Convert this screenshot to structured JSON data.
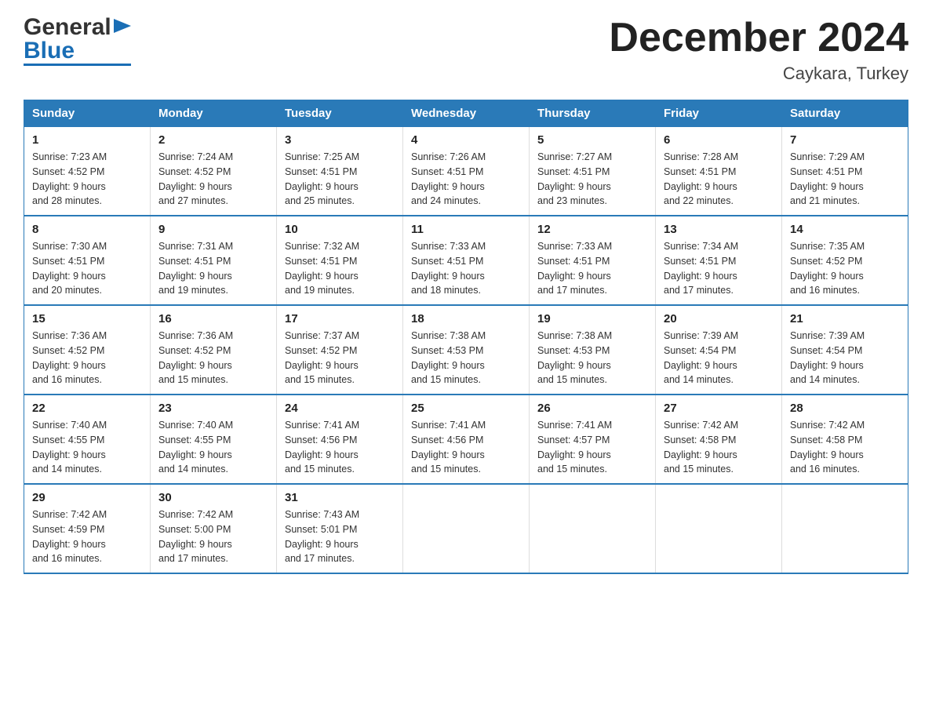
{
  "logo": {
    "text_general": "General",
    "text_blue": "Blue",
    "arrow": "▶"
  },
  "title": {
    "month_year": "December 2024",
    "location": "Caykara, Turkey"
  },
  "weekdays": [
    "Sunday",
    "Monday",
    "Tuesday",
    "Wednesday",
    "Thursday",
    "Friday",
    "Saturday"
  ],
  "weeks": [
    [
      {
        "day": "1",
        "sunrise": "7:23 AM",
        "sunset": "4:52 PM",
        "daylight": "9 hours and 28 minutes."
      },
      {
        "day": "2",
        "sunrise": "7:24 AM",
        "sunset": "4:52 PM",
        "daylight": "9 hours and 27 minutes."
      },
      {
        "day": "3",
        "sunrise": "7:25 AM",
        "sunset": "4:51 PM",
        "daylight": "9 hours and 25 minutes."
      },
      {
        "day": "4",
        "sunrise": "7:26 AM",
        "sunset": "4:51 PM",
        "daylight": "9 hours and 24 minutes."
      },
      {
        "day": "5",
        "sunrise": "7:27 AM",
        "sunset": "4:51 PM",
        "daylight": "9 hours and 23 minutes."
      },
      {
        "day": "6",
        "sunrise": "7:28 AM",
        "sunset": "4:51 PM",
        "daylight": "9 hours and 22 minutes."
      },
      {
        "day": "7",
        "sunrise": "7:29 AM",
        "sunset": "4:51 PM",
        "daylight": "9 hours and 21 minutes."
      }
    ],
    [
      {
        "day": "8",
        "sunrise": "7:30 AM",
        "sunset": "4:51 PM",
        "daylight": "9 hours and 20 minutes."
      },
      {
        "day": "9",
        "sunrise": "7:31 AM",
        "sunset": "4:51 PM",
        "daylight": "9 hours and 19 minutes."
      },
      {
        "day": "10",
        "sunrise": "7:32 AM",
        "sunset": "4:51 PM",
        "daylight": "9 hours and 19 minutes."
      },
      {
        "day": "11",
        "sunrise": "7:33 AM",
        "sunset": "4:51 PM",
        "daylight": "9 hours and 18 minutes."
      },
      {
        "day": "12",
        "sunrise": "7:33 AM",
        "sunset": "4:51 PM",
        "daylight": "9 hours and 17 minutes."
      },
      {
        "day": "13",
        "sunrise": "7:34 AM",
        "sunset": "4:51 PM",
        "daylight": "9 hours and 17 minutes."
      },
      {
        "day": "14",
        "sunrise": "7:35 AM",
        "sunset": "4:52 PM",
        "daylight": "9 hours and 16 minutes."
      }
    ],
    [
      {
        "day": "15",
        "sunrise": "7:36 AM",
        "sunset": "4:52 PM",
        "daylight": "9 hours and 16 minutes."
      },
      {
        "day": "16",
        "sunrise": "7:36 AM",
        "sunset": "4:52 PM",
        "daylight": "9 hours and 15 minutes."
      },
      {
        "day": "17",
        "sunrise": "7:37 AM",
        "sunset": "4:52 PM",
        "daylight": "9 hours and 15 minutes."
      },
      {
        "day": "18",
        "sunrise": "7:38 AM",
        "sunset": "4:53 PM",
        "daylight": "9 hours and 15 minutes."
      },
      {
        "day": "19",
        "sunrise": "7:38 AM",
        "sunset": "4:53 PM",
        "daylight": "9 hours and 15 minutes."
      },
      {
        "day": "20",
        "sunrise": "7:39 AM",
        "sunset": "4:54 PM",
        "daylight": "9 hours and 14 minutes."
      },
      {
        "day": "21",
        "sunrise": "7:39 AM",
        "sunset": "4:54 PM",
        "daylight": "9 hours and 14 minutes."
      }
    ],
    [
      {
        "day": "22",
        "sunrise": "7:40 AM",
        "sunset": "4:55 PM",
        "daylight": "9 hours and 14 minutes."
      },
      {
        "day": "23",
        "sunrise": "7:40 AM",
        "sunset": "4:55 PM",
        "daylight": "9 hours and 14 minutes."
      },
      {
        "day": "24",
        "sunrise": "7:41 AM",
        "sunset": "4:56 PM",
        "daylight": "9 hours and 15 minutes."
      },
      {
        "day": "25",
        "sunrise": "7:41 AM",
        "sunset": "4:56 PM",
        "daylight": "9 hours and 15 minutes."
      },
      {
        "day": "26",
        "sunrise": "7:41 AM",
        "sunset": "4:57 PM",
        "daylight": "9 hours and 15 minutes."
      },
      {
        "day": "27",
        "sunrise": "7:42 AM",
        "sunset": "4:58 PM",
        "daylight": "9 hours and 15 minutes."
      },
      {
        "day": "28",
        "sunrise": "7:42 AM",
        "sunset": "4:58 PM",
        "daylight": "9 hours and 16 minutes."
      }
    ],
    [
      {
        "day": "29",
        "sunrise": "7:42 AM",
        "sunset": "4:59 PM",
        "daylight": "9 hours and 16 minutes."
      },
      {
        "day": "30",
        "sunrise": "7:42 AM",
        "sunset": "5:00 PM",
        "daylight": "9 hours and 17 minutes."
      },
      {
        "day": "31",
        "sunrise": "7:43 AM",
        "sunset": "5:01 PM",
        "daylight": "9 hours and 17 minutes."
      },
      null,
      null,
      null,
      null
    ]
  ],
  "labels": {
    "sunrise": "Sunrise:",
    "sunset": "Sunset:",
    "daylight": "Daylight:"
  }
}
